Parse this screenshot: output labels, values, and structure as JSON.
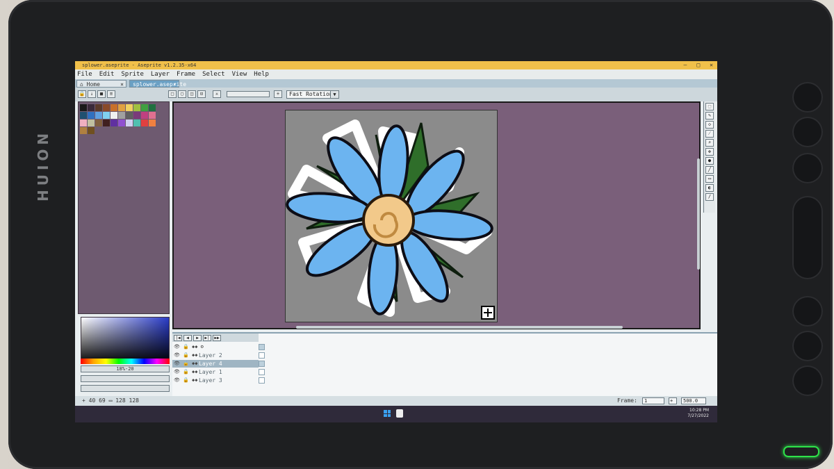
{
  "device": {
    "brand": "HUION"
  },
  "window": {
    "title": "splower.aseprite - Aseprite v1.2.35-x64"
  },
  "menu": [
    "File",
    "Edit",
    "Sprite",
    "Layer",
    "Frame",
    "Select",
    "View",
    "Help"
  ],
  "tabs": [
    {
      "label": "Home",
      "close": "×"
    },
    {
      "label": "splower.aseprite",
      "close": "×"
    }
  ],
  "toolbar": {
    "rotation_mode": "Fast Rotation"
  },
  "palette": [
    "#1a1a1a",
    "#3a2a3a",
    "#5a3a2a",
    "#8a4a2a",
    "#c8702a",
    "#e0a040",
    "#f0d060",
    "#a0c040",
    "#40a040",
    "#207040",
    "#205070",
    "#3070c0",
    "#60a0e0",
    "#80d0f0",
    "#f0f0f0",
    "#a0a0a0",
    "#606060",
    "#7a3a7a",
    "#c04080",
    "#e07090",
    "#f0b0c0",
    "#c0c0a0",
    "#806040",
    "#402020",
    "#6030a0",
    "#9050d0",
    "#d0d0f0",
    "#50c0b0",
    "#e04040",
    "#f08040",
    "#b08040",
    "#705020"
  ],
  "color_values": {
    "fg": "18%-20"
  },
  "layers": [
    {
      "name": "Layer 2"
    },
    {
      "name": "Layer 4",
      "selected": true
    },
    {
      "name": "Layer 1"
    },
    {
      "name": "Layer 3"
    }
  ],
  "status": {
    "coords": "40 69",
    "size": "128 128",
    "frame_label": "Frame:",
    "frame_value": "1",
    "zoom": "500.0"
  },
  "taskbar": {
    "time": "10:28 PM",
    "date": "7/27/2022"
  }
}
